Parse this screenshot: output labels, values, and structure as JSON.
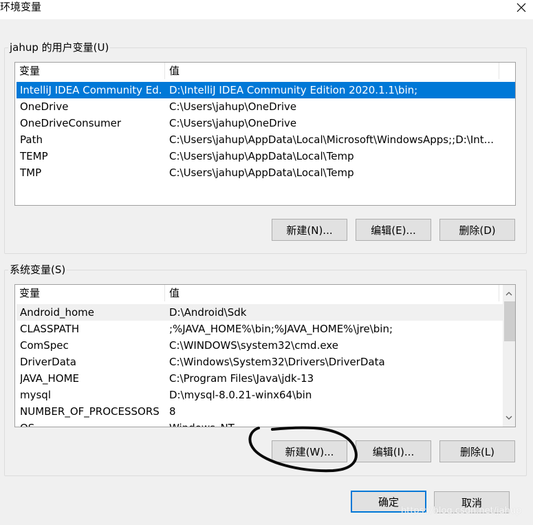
{
  "window": {
    "title": "环境变量"
  },
  "user_group": {
    "label": "jahup 的用户变量(U)",
    "columns": [
      "变量",
      "值"
    ],
    "rows": [
      {
        "name": "IntelliJ IDEA Community Ed...",
        "value": "D:\\IntelliJ IDEA Community Edition 2020.1.1\\bin;",
        "selected": true
      },
      {
        "name": "OneDrive",
        "value": "C:\\Users\\jahup\\OneDrive"
      },
      {
        "name": "OneDriveConsumer",
        "value": "C:\\Users\\jahup\\OneDrive"
      },
      {
        "name": "Path",
        "value": "C:\\Users\\jahup\\AppData\\Local\\Microsoft\\WindowsApps;;D:\\Int..."
      },
      {
        "name": "TEMP",
        "value": "C:\\Users\\jahup\\AppData\\Local\\Temp"
      },
      {
        "name": "TMP",
        "value": "C:\\Users\\jahup\\AppData\\Local\\Temp"
      }
    ],
    "buttons": {
      "new": "新建(N)...",
      "edit": "编辑(E)...",
      "delete": "删除(D)"
    }
  },
  "system_group": {
    "label": "系统变量(S)",
    "columns": [
      "变量",
      "值"
    ],
    "rows": [
      {
        "name": "Android_home",
        "value": "D:\\Android\\Sdk",
        "hover": true
      },
      {
        "name": "CLASSPATH",
        "value": ";%JAVA_HOME%\\bin;%JAVA_HOME%\\jre\\bin;"
      },
      {
        "name": "ComSpec",
        "value": "C:\\WINDOWS\\system32\\cmd.exe"
      },
      {
        "name": "DriverData",
        "value": "C:\\Windows\\System32\\Drivers\\DriverData"
      },
      {
        "name": "JAVA_HOME",
        "value": "C:\\Program Files\\Java\\jdk-13"
      },
      {
        "name": "mysql",
        "value": "D:\\mysql-8.0.21-winx64\\bin"
      },
      {
        "name": "NUMBER_OF_PROCESSORS",
        "value": "8"
      },
      {
        "name": "OS",
        "value": "Windows_NT"
      }
    ],
    "buttons": {
      "new": "新建(W)...",
      "edit": "编辑(I)...",
      "delete": "删除(L)"
    }
  },
  "footer": {
    "ok": "确定",
    "cancel": "取消"
  },
  "watermark": "https://blog.csdn.net/jahup"
}
